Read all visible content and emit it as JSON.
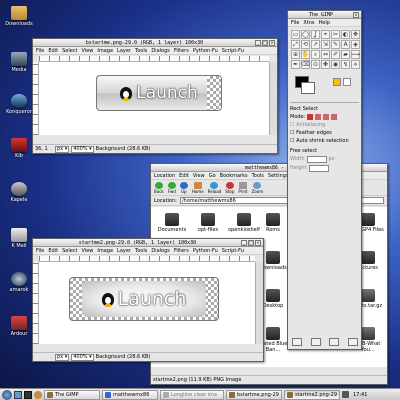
{
  "desktop": {
    "icons": [
      "Downloads",
      "Media",
      "Konqueror",
      "Kib",
      "Kapele",
      "K Mail",
      "amarok",
      "Ardour"
    ]
  },
  "gimp_window_1": {
    "title": "bstartme.png-29.0 (RGB, 1 layer) 100x30",
    "menu": [
      "File",
      "Edit",
      "Select",
      "View",
      "Image",
      "Layer",
      "Tools",
      "Dialogs",
      "Filters",
      "Python-Fu",
      "Script-Fu"
    ],
    "image_text": "Launch",
    "coords": "36, 1",
    "unit": "px",
    "zoom": "400%",
    "status": "Background (28.6 KB)"
  },
  "gimp_window_2": {
    "title": "startme2.png-29.0 (RGB, 1 layer) 100x30",
    "menu": [
      "File",
      "Edit",
      "Select",
      "View",
      "Image",
      "Layer",
      "Tools",
      "Dialogs",
      "Filters",
      "Python-Fu",
      "Script-Fu"
    ],
    "image_text": "Launch",
    "unit": "px",
    "zoom": "400%",
    "status": "Background (28.6 KB)"
  },
  "toolbox": {
    "title": "The GIMP",
    "menu": [
      "File",
      "Xtns",
      "Help"
    ],
    "tools": [
      "▭",
      "◯",
      "ʆ",
      "⌖",
      "✂",
      "◐",
      "✥",
      "⤢",
      "⟲",
      "↗",
      "⇲",
      "✎",
      "A",
      "◈",
      "⊕",
      "✋",
      "⌕",
      "⇔",
      "✐",
      "▰",
      "⟿",
      "✒",
      "⌫",
      "⊙",
      "✤",
      "◉",
      "↯",
      "⟡"
    ],
    "rect_select": "Rect Select",
    "mode_label": "Mode:",
    "opt_antialias": "Antialiasing",
    "opt_feather": "Feather edges",
    "opt_auto": "Auto shrink selection",
    "free_select": "Free select",
    "width_label": "Width",
    "height_label": "Height",
    "unit": "px"
  },
  "konqueror": {
    "title": "matthewmx86 - Ko",
    "menu": [
      "Location",
      "Edit",
      "View",
      "Go",
      "Bookmarks",
      "Tools",
      "Settings"
    ],
    "toolbar": [
      "Back",
      "Fwd",
      "Up",
      "Home",
      "Reload",
      "Stop",
      "Print",
      "Zoom"
    ],
    "location_label": "Location:",
    "location_value": "/home/matthewmx86",
    "files": [
      "Documents",
      "opt-files",
      "openkioshelf",
      "Roms",
      "My GP4 Files",
      "Downloads",
      "Pictures",
      "Desktop",
      "fonts.tar.gz",
      "Twisted Blues Ban...",
      "TBB-What You..."
    ],
    "status": "startme2.png (11.9 KB) PNG Image"
  },
  "taskbar": {
    "items": [
      "The GIMP",
      "matthewmx86",
      "Longline clear ima",
      "bstartme.png-29",
      "startme2.png-29"
    ],
    "clock": "17:41"
  },
  "colors": {
    "accent": "#3e63c4",
    "window": "#e6e6e6"
  }
}
